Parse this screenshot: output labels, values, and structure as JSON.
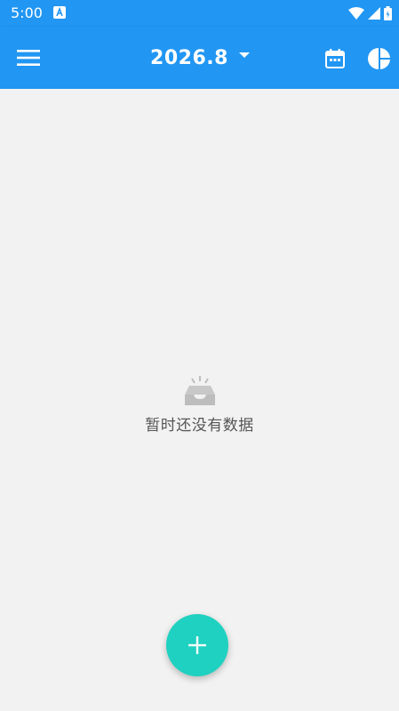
{
  "status_bar": {
    "time": "5:00",
    "notification_icon": "android-a-icon",
    "wifi_icon": "wifi-icon",
    "signal_icon": "signal-icon",
    "battery_icon": "battery-icon"
  },
  "app_bar": {
    "menu_icon": "menu-icon",
    "month": "2026.8",
    "dropdown_icon": "chevron-down-icon",
    "calendar_icon": "calendar-icon",
    "stats_icon": "pie-chart-icon"
  },
  "empty_state": {
    "icon": "empty-inbox-icon",
    "message": "暂时还没有数据"
  },
  "fab": {
    "icon": "plus-icon"
  },
  "colors": {
    "primary": "#2196f3",
    "fab": "#1fd1c0",
    "background": "#f2f2f2",
    "empty_text": "#555555"
  }
}
